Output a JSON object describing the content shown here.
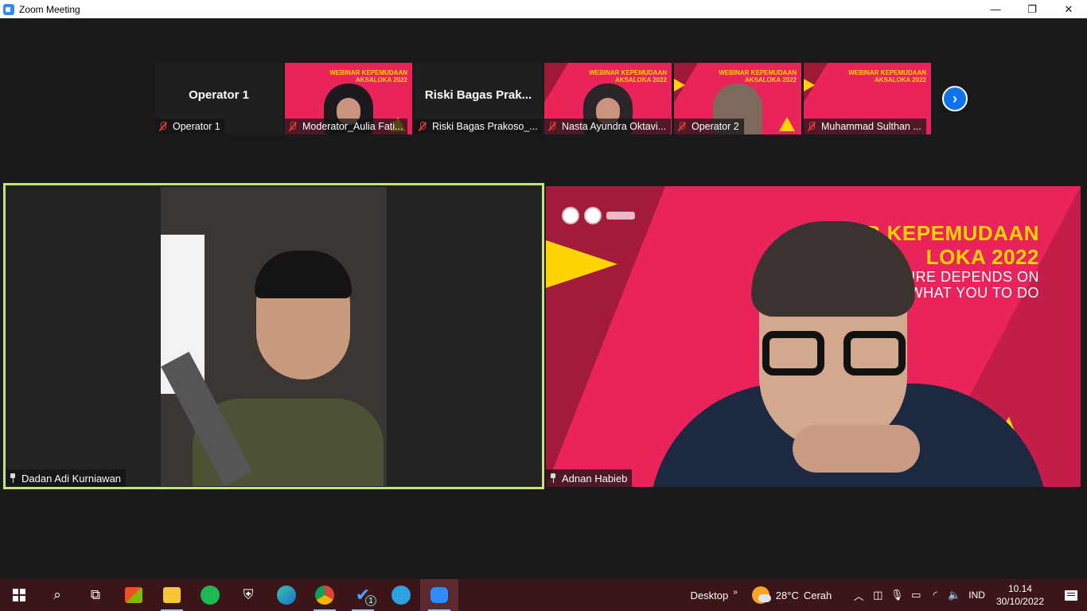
{
  "window": {
    "title": "Zoom Meeting",
    "controls": {
      "minimize": "—",
      "restore": "❐",
      "close": "✕"
    }
  },
  "strip": {
    "tiles": [
      {
        "big_name": "Operator 1",
        "label": "Operator 1",
        "muted": true,
        "type": "name-only"
      },
      {
        "label": "Moderator_Aulia Fati...",
        "muted": true,
        "type": "video",
        "banner": [
          "WEBINAR KEPEMUDAAN",
          "AKSALOKA 2022"
        ]
      },
      {
        "big_name": "Riski Bagas Prak...",
        "label": "Riski Bagas Prakoso_...",
        "muted": true,
        "type": "name-only"
      },
      {
        "label": "Nasta Ayundra Oktavi...",
        "muted": true,
        "type": "video",
        "banner": [
          "WEBINAR KEPEMUDAAN",
          "AKSALOKA 2022"
        ]
      },
      {
        "label": "Operator 2",
        "muted": true,
        "type": "video",
        "banner": [
          "WEBINAR KEPEMUDAAN",
          "AKSALOKA 2022"
        ]
      },
      {
        "label": "Muhammad Sulthan ...",
        "muted": true,
        "type": "video",
        "banner": [
          "WEBINAR KEPEMUDAAN",
          "AKSALOKA 2022"
        ]
      }
    ],
    "next_icon": "chevron-right-icon"
  },
  "main": {
    "left": {
      "name": "Dadan Adi Kurniawan",
      "pinned": true,
      "active_speaker_border": "#c6e37a"
    },
    "right": {
      "name": "Adnan Habieb",
      "pinned": true,
      "banner_line1": "WEB      KEPEMUDAAN",
      "banner_line2": "LOKA 2022",
      "banner_line3": "URE DEPENDS ON",
      "banner_line4": "WHAT YOU TO DO"
    }
  },
  "taskbar": {
    "apps": [
      {
        "name": "start",
        "icon": "windows-icon"
      },
      {
        "name": "search",
        "icon": "search-icon"
      },
      {
        "name": "task-view",
        "icon": "task-view-icon"
      },
      {
        "name": "store",
        "icon": "store-icon"
      },
      {
        "name": "file-explorer",
        "icon": "folder-icon",
        "active": true
      },
      {
        "name": "spotify",
        "icon": "spotify-icon"
      },
      {
        "name": "security",
        "icon": "shield-icon"
      },
      {
        "name": "edge",
        "icon": "edge-icon"
      },
      {
        "name": "chrome",
        "icon": "chrome-icon",
        "active": true
      },
      {
        "name": "todo",
        "icon": "check-icon",
        "badge": "1",
        "active": true
      },
      {
        "name": "telegram",
        "icon": "telegram-icon"
      },
      {
        "name": "zoom",
        "icon": "zoom-icon",
        "current": true
      }
    ],
    "tray": {
      "desktop_label": "Desktop",
      "chevron": "»",
      "temperature": "28°C",
      "condition": "Cerah",
      "language": "IND",
      "time": "10.14",
      "date": "30/10/2022"
    }
  },
  "colors": {
    "accent": "#0e72ed",
    "banner_pink": "#e8245a",
    "banner_yellow": "#ffd400",
    "muted_red": "#e53935",
    "taskbar_bg": "#3b1518"
  }
}
